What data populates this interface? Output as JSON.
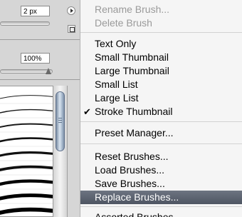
{
  "palette": {
    "diameter_value": "2 px",
    "spacing_value": "100%",
    "brush_strokes": [
      {
        "w": 1.0,
        "c": "#1a1a1a"
      },
      {
        "w": 1.4,
        "c": "#1a1a1a"
      },
      {
        "w": 2.0,
        "c": "#1a1a1a"
      },
      {
        "w": 2.6,
        "c": "#111"
      },
      {
        "w": 3.2,
        "c": "#111"
      },
      {
        "w": 3.8,
        "c": "#111"
      },
      {
        "w": 4.4,
        "c": "#000"
      },
      {
        "w": 5.0,
        "c": "#000"
      },
      {
        "w": 5.6,
        "c": "#000"
      }
    ]
  },
  "menu": {
    "items": [
      {
        "label": "Rename Brush...",
        "disabled": true
      },
      {
        "label": "Delete Brush",
        "disabled": true
      },
      {
        "label": "Text Only"
      },
      {
        "label": "Small Thumbnail"
      },
      {
        "label": "Large Thumbnail"
      },
      {
        "label": "Small List"
      },
      {
        "label": "Large List"
      },
      {
        "label": "Stroke Thumbnail",
        "checked": true
      },
      {
        "label": "Preset Manager..."
      },
      {
        "label": "Reset Brushes..."
      },
      {
        "label": "Load Brushes..."
      },
      {
        "label": "Save Brushes..."
      },
      {
        "label": "Replace Brushes...",
        "highlighted": true
      },
      {
        "label": "Assorted Brushes"
      }
    ],
    "check_glyph": "✔"
  },
  "colors": {
    "highlight": "#555c69",
    "disabled_text": "#9a9a9a"
  }
}
